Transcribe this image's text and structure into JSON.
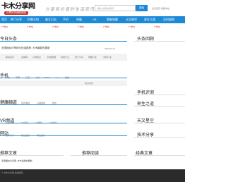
{
  "header": {
    "logo_text": "卡木分享网",
    "logo_sub": "分享好东西的网站",
    "slogan": "分享有价值的生活资讯",
    "search_placeholder": "请输入搜索关键词",
    "search_button": "搜索",
    "toplinks": "设为首页   收藏本站"
  },
  "nav": [
    "首页",
    "热门分享",
    "科教天地",
    "美文日志",
    "手机",
    "电脑",
    "VR",
    "智能穿戴",
    "天文星空",
    "养生之道",
    "百科指南"
  ],
  "ads": [
    "广告位",
    "广告位",
    "广告位",
    "广告位",
    "广告位",
    "广告位",
    "广告位"
  ],
  "sections": {
    "today": "今日头条",
    "headlines": "头条回顾",
    "featured_title": "无限相似分享网与优选推荐_卡木最新的更新",
    "featured_date": "2023-01-11",
    "tags1": [
      "移动资讯",
      "互联网",
      "人物观点",
      "科技数据",
      "科技行业",
      "热门分享",
      "电脑行业",
      "手机行业"
    ],
    "phone": "手机",
    "phone_tags": [
      "华为",
      "苹果",
      "三星",
      "小米",
      "OPPO",
      "vivo",
      "魅族"
    ],
    "phone_sub": "热点资讯",
    "phone_review": "手机评测",
    "health": "健康频道",
    "health_tags": [
      "男性健康",
      "营养保健",
      "心理保健",
      "两性"
    ],
    "health_right": "养生之道",
    "vr": "VR频道",
    "vr_tags": [
      "行业新闻",
      "VR游戏",
      "VR硬件",
      "VR影视"
    ],
    "astronomy": "天文星空",
    "website": "网站",
    "website_tags": [
      "技术分享",
      "建站经验",
      "网站优化"
    ],
    "tech": "技术分享",
    "recommend": "推荐文章",
    "recommend_read": "推荐阅读",
    "classic": "经典文章",
    "recommend_item": "无限相似分享网_卡木最新的更新"
  },
  "footer": {
    "text": "© 卡木分享网 版权所有"
  }
}
